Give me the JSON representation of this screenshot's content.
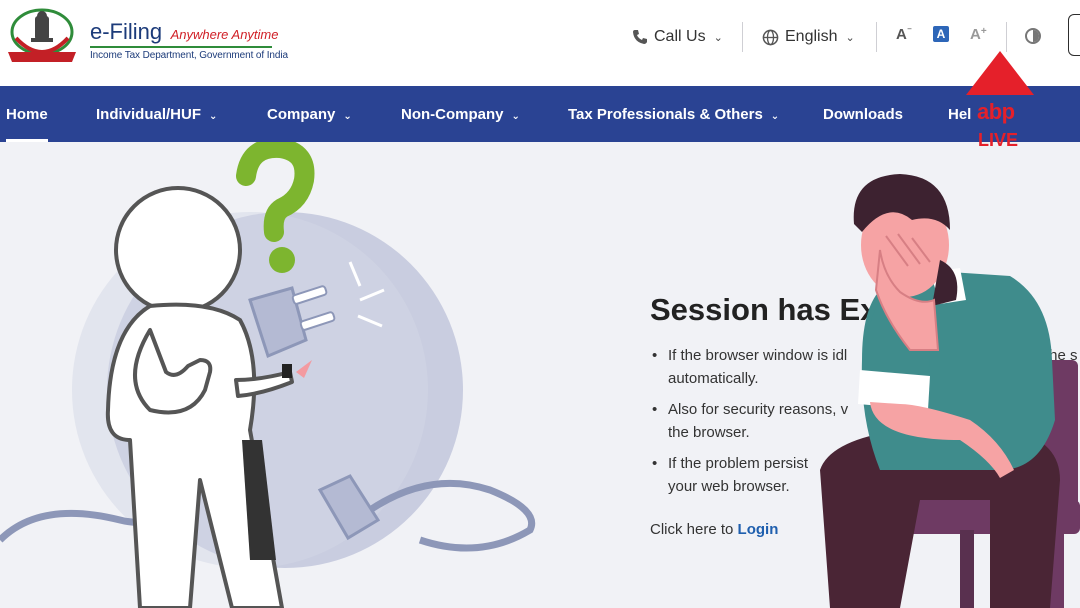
{
  "header": {
    "brand_name": "e-Filing",
    "brand_tagline": "Anywhere Anytime",
    "brand_subtitle": "Income Tax Department, Government of India",
    "call_us": "Call Us",
    "language": "English",
    "font_decrease": "A",
    "font_default": "A",
    "font_increase": "A",
    "font_increase_sup": "+"
  },
  "nav": {
    "items": [
      {
        "label": "Home"
      },
      {
        "label": "Individual/HUF"
      },
      {
        "label": "Company"
      },
      {
        "label": "Non-Company"
      },
      {
        "label": "Tax Professionals & Others"
      },
      {
        "label": "Downloads"
      },
      {
        "label": "Hel"
      }
    ]
  },
  "session": {
    "title": "Session has Ex",
    "bullets": [
      "If the browser window is idl",
      "the s",
      "automatically.",
      "Also for security reasons, v",
      "the browser.",
      "If the problem persist",
      "your web browser."
    ],
    "login_prefix": "Click here to",
    "login_link": "Login"
  },
  "watermark": {
    "brand": "abp",
    "live": "LIVE"
  },
  "icons": {
    "phone": "phone-icon",
    "globe": "globe-icon",
    "contrast": "contrast-icon",
    "emblem": "national-emblem-icon",
    "question": "question-mark-icon"
  },
  "colors": {
    "nav_bg": "#2a4393",
    "brand_red": "#d01f26",
    "link_blue": "#1f5fae",
    "abp_red": "#e5202a",
    "question_green": "#7db52f",
    "shirt_teal": "#3f8c8c",
    "chair_purple": "#6e3a63"
  }
}
